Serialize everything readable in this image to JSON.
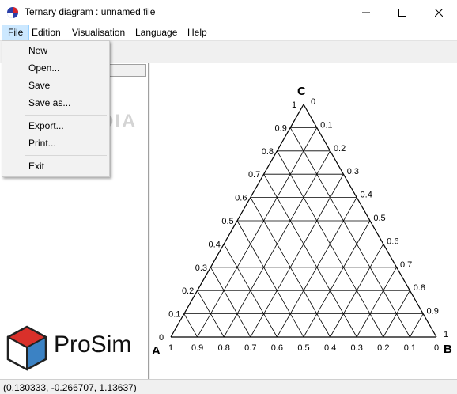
{
  "window": {
    "title": "Ternary diagram : unnamed file"
  },
  "menu": {
    "items": [
      "File",
      "Edition",
      "Visualisation",
      "Language",
      "Help"
    ]
  },
  "file_menu": {
    "new": "New",
    "open": "Open...",
    "save": "Save",
    "save_as": "Save as...",
    "export": "Export...",
    "print": "Print...",
    "exit": "Exit"
  },
  "watermark": "SOFTPEDIA",
  "logo": {
    "text": "ProSim"
  },
  "status": {
    "coords": "(0.130333, -0.266707, 1.13637)"
  },
  "ternary": {
    "vertex_a": "A",
    "vertex_b": "B",
    "vertex_c": "C",
    "bottom_labels": [
      "1",
      "0.9",
      "0.8",
      "0.7",
      "0.6",
      "0.5",
      "0.4",
      "0.3",
      "0.2",
      "0.1",
      "0"
    ],
    "left_labels": [
      "0",
      "0.1",
      "0.2",
      "0.3",
      "0.4",
      "0.5",
      "0.6",
      "0.7",
      "0.8",
      "0.9",
      "1"
    ],
    "right_labels": [
      "0",
      "0.1",
      "0.2",
      "0.3",
      "0.4",
      "0.5",
      "0.6",
      "0.7",
      "0.8",
      "0.9",
      "1"
    ]
  },
  "colors": {
    "menu_active": "#cce8ff",
    "logo_blue": "#3b82c4",
    "logo_red": "#d9302a"
  }
}
